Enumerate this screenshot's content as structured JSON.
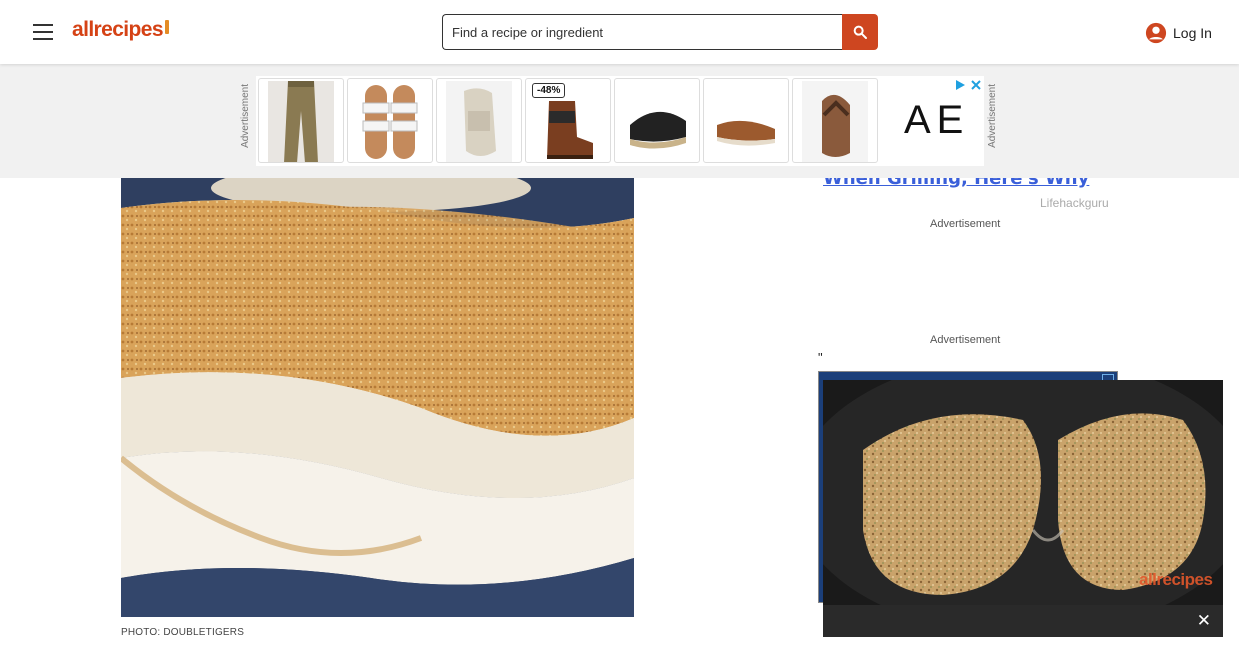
{
  "header": {
    "logo_text": "allrecipes",
    "search_placeholder": "Find a recipe or ingredient",
    "login_label": "Log In"
  },
  "ad_banner": {
    "label_left": "Advertisement",
    "label_right": "Advertisement",
    "discount_badge": "-48%",
    "brand_text": "AE"
  },
  "main": {
    "photo_credit": "PHOTO: DOUBLETIGERS"
  },
  "sidebar": {
    "promo_link": "When Grilling, Here's Why",
    "promo_source": "Lifehackguru",
    "ad_label_1": "Advertisement",
    "ad_label_2": "Advertisement",
    "stray_quote": "\""
  },
  "video": {
    "watermark": "allrecipes",
    "close_label": "✕"
  },
  "colors": {
    "brand": "#ce4620",
    "link": "#3a5fd9"
  }
}
